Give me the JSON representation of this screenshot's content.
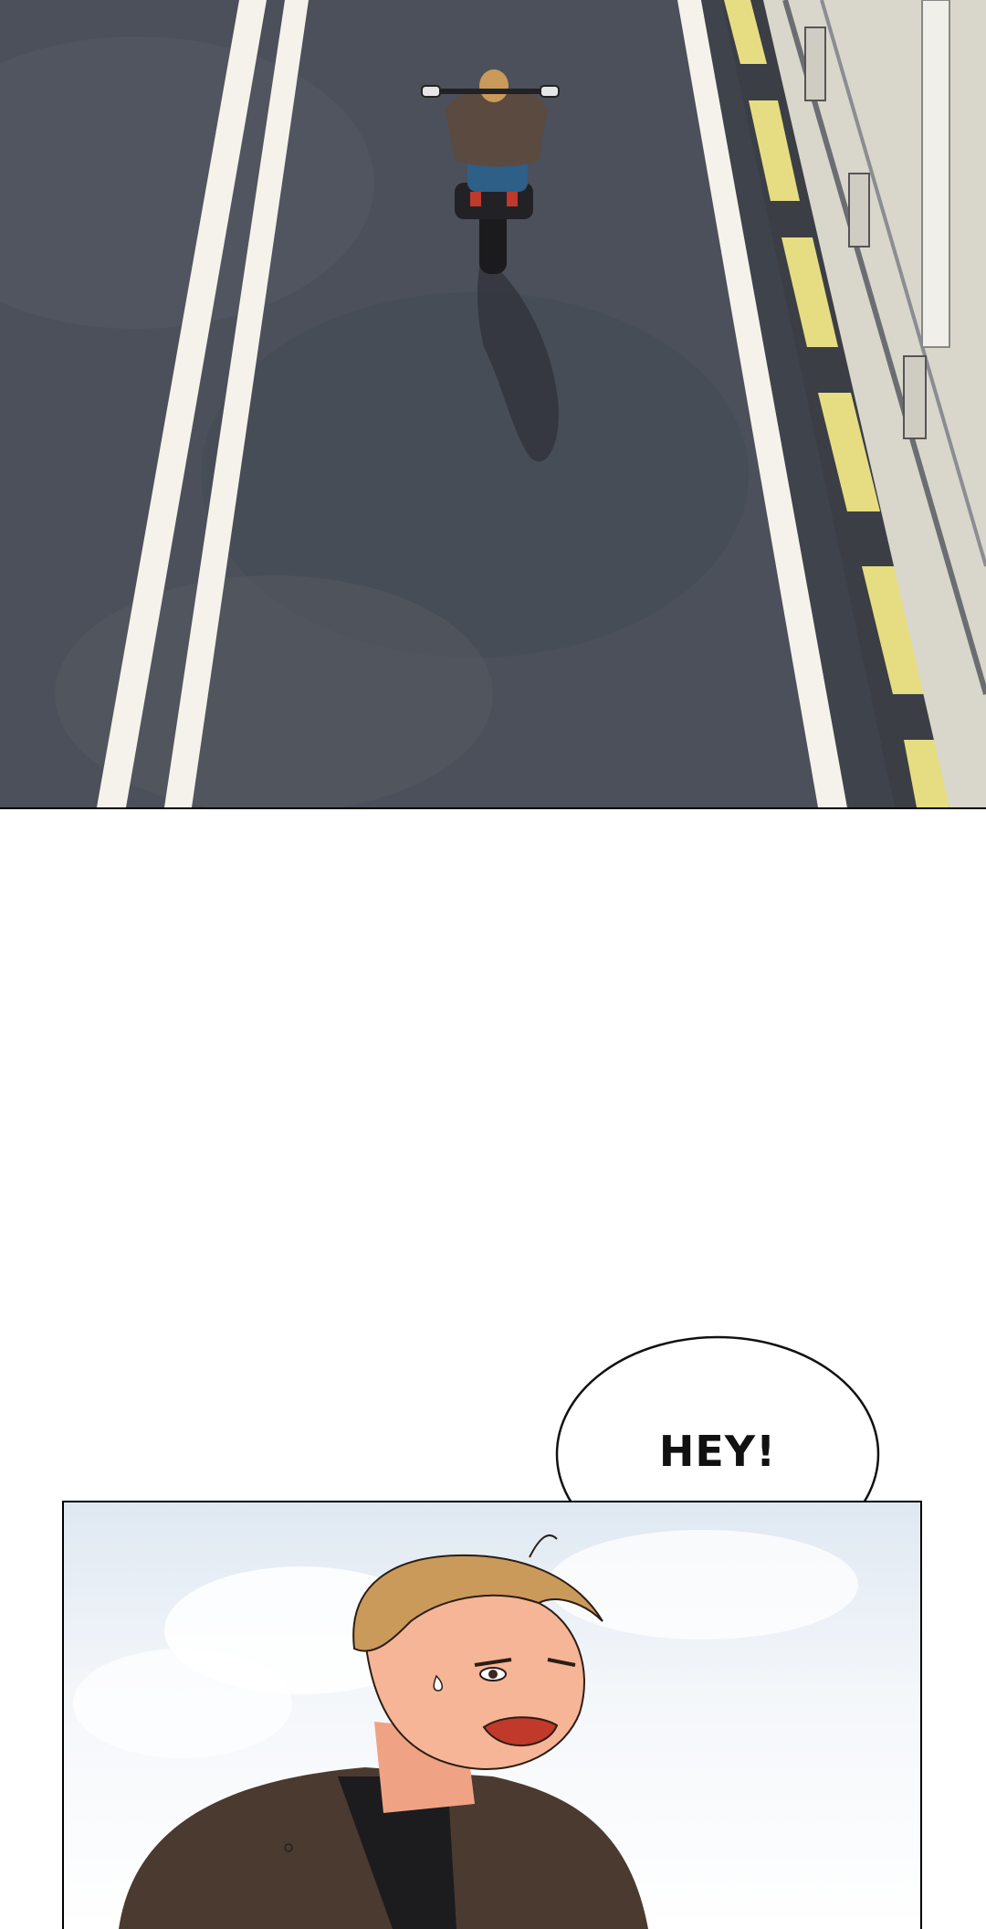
{
  "speech": {
    "text": "HEY!"
  },
  "colors": {
    "asphalt": "#4a4f59",
    "lane_line": "#f4f2ea",
    "barrier_yellow": "#e6dd82",
    "barrier_dark": "#3b3e45",
    "sky": "#dfe8f2",
    "hair": "#c99a5a",
    "skin": "#f0a384",
    "jacket": "#4a3a30"
  }
}
